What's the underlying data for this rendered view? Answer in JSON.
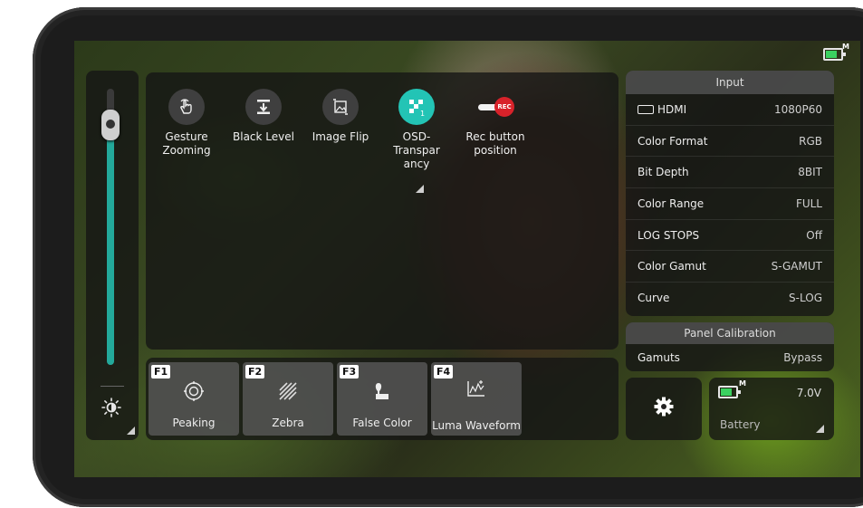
{
  "status": {
    "battery_mode": "M"
  },
  "left": {
    "brightness_level": 0.87,
    "brightness_icon": "brightness-icon"
  },
  "functions": [
    {
      "label": "Gesture Zooming",
      "icon": "gesture-hand-icon"
    },
    {
      "label": "Black Level",
      "icon": "black-level-icon"
    },
    {
      "label": "Image Flip",
      "icon": "image-flip-icon"
    },
    {
      "label": "OSD-Transpar ancy",
      "icon": "osd-transparency-icon",
      "badge": "1"
    },
    {
      "label": "Rec button position",
      "icon": "rec-toggle-icon",
      "rec_text": "REC"
    }
  ],
  "fkeys": [
    {
      "tag": "F1",
      "label": "Peaking",
      "icon": "peaking-icon"
    },
    {
      "tag": "F2",
      "label": "Zebra",
      "icon": "zebra-icon"
    },
    {
      "tag": "F3",
      "label": "False Color",
      "icon": "false-color-icon"
    },
    {
      "tag": "F4",
      "label": "Luma Waveform",
      "icon": "waveform-icon"
    }
  ],
  "input": {
    "title": "Input",
    "rows": [
      {
        "label": "HDMI",
        "value": "1080P60"
      },
      {
        "label": "Color Format",
        "value": "RGB"
      },
      {
        "label": "Bit Depth",
        "value": "8BIT"
      },
      {
        "label": "Color Range",
        "value": "FULL"
      },
      {
        "label": "LOG STOPS",
        "value": "Off"
      },
      {
        "label": "Color Gamut",
        "value": "S-GAMUT"
      },
      {
        "label": "Curve",
        "value": "S-LOG"
      }
    ]
  },
  "calibration": {
    "title": "Panel Calibration",
    "label": "Gamuts",
    "value": "Bypass"
  },
  "battery": {
    "mode": "M",
    "voltage": "7.0V",
    "label": "Battery"
  },
  "colors": {
    "accent": "#23c4b5",
    "slider": "#23a99b",
    "battery_green": "#3bd160",
    "rec_red": "#d8222a"
  }
}
